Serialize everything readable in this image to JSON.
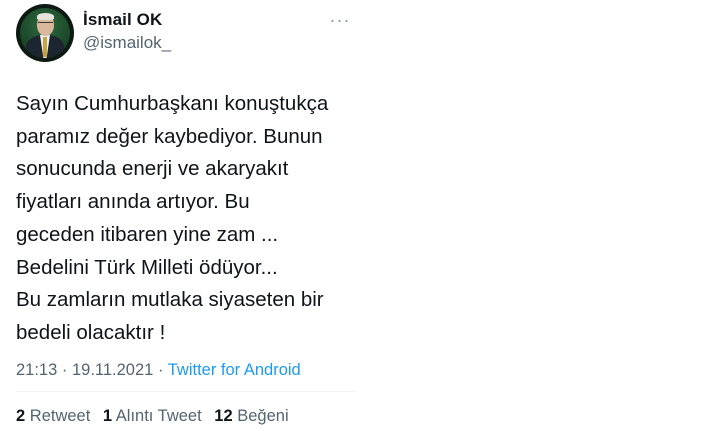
{
  "tweet": {
    "author": {
      "display_name": "İsmail OK",
      "handle": "@ismailok_"
    },
    "more_icon": "more-horizontal-icon",
    "more_glyph": "···",
    "text": "Sayın Cumhurbaşkanı konuştukça\nparamız değer kaybediyor. Bunun\nsonucunda enerji ve akaryakıt\nfiyatları anında artıyor. Bu\ngeceden itibaren yine zam ...\nBedelini Türk Milleti ödüyor...\nBu zamların mutlaka siyaseten bir\nbedeli olacaktır !",
    "time": "21:13",
    "separator": "·",
    "date": "19.11.2021",
    "source": "Twitter for Android",
    "stats": {
      "retweets": {
        "count": "2",
        "label": "Retweet"
      },
      "quotes": {
        "count": "1",
        "label": "Alıntı Tweet"
      },
      "likes": {
        "count": "12",
        "label": "Beğeni"
      }
    }
  },
  "colors": {
    "text": "#0f1419",
    "secondary": "#536471",
    "link": "#1d9bf0",
    "divider": "#eff3f4"
  }
}
